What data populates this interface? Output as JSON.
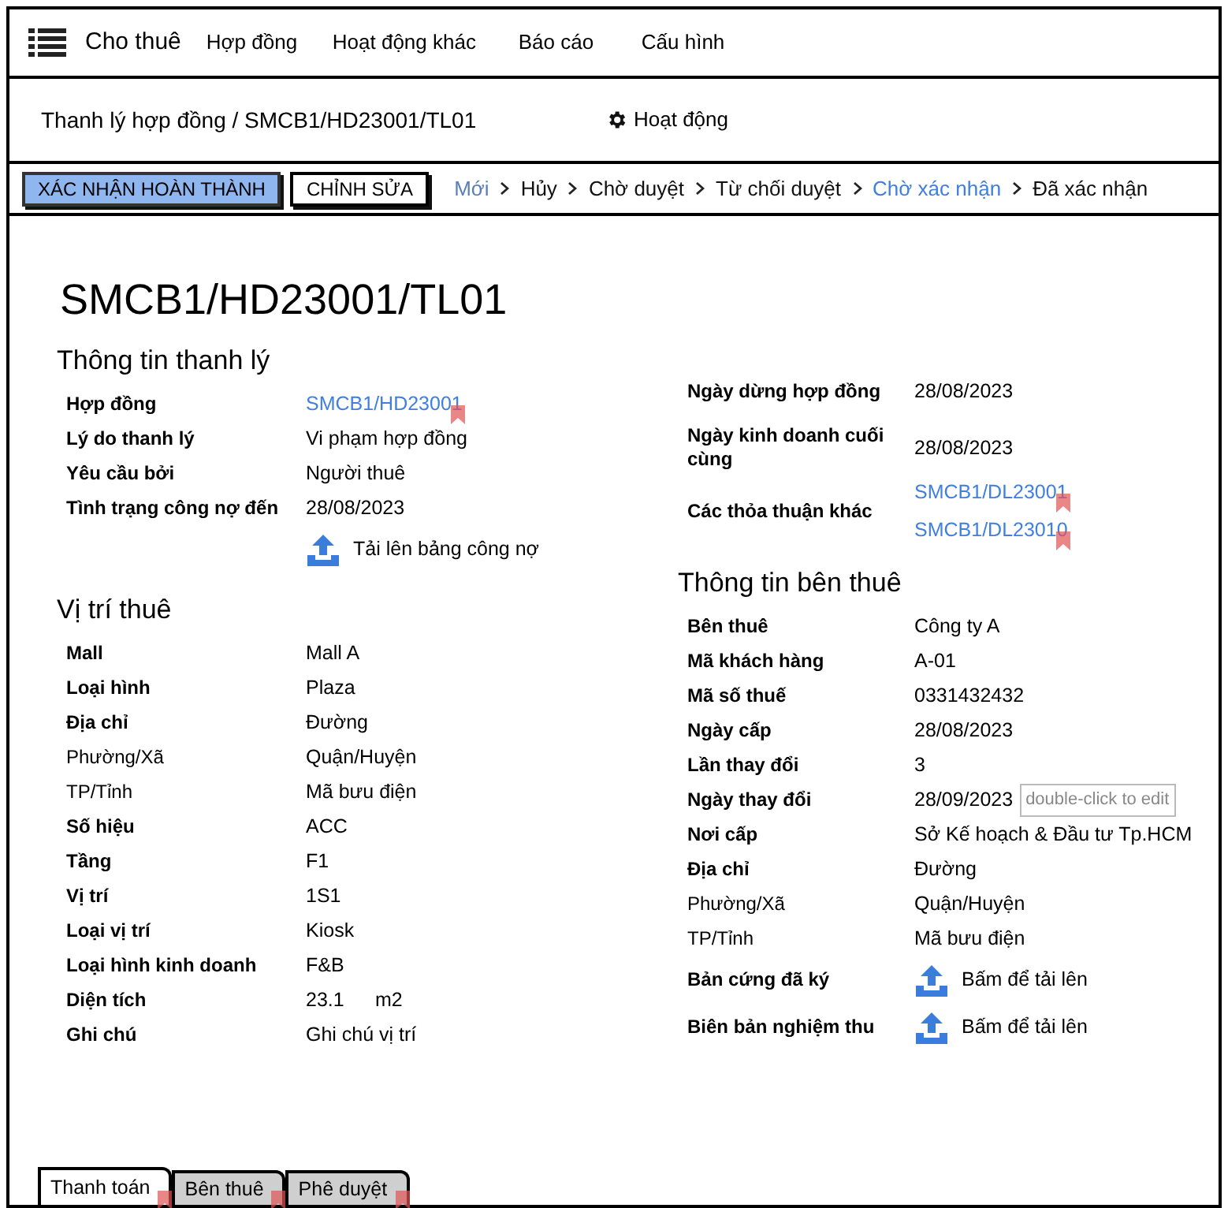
{
  "nav": {
    "brand": "Cho thuê",
    "items": [
      "Hợp đồng",
      "Hoạt động khác",
      "Báo cáo",
      "Cấu hình"
    ]
  },
  "breadcrumb": {
    "title": "Thanh lý hợp đồng / SMCB1/HD23001/TL01",
    "action": "Hoạt động"
  },
  "buttons": [
    {
      "label": "XÁC NHẬN HOÀN THÀNH",
      "primary": true
    },
    {
      "label": "CHỈNH SỬA",
      "primary": false
    }
  ],
  "steps": [
    {
      "label": "Mới",
      "done": true,
      "selected": false
    },
    {
      "label": "Hủy",
      "done": false,
      "selected": false
    },
    {
      "label": "Chờ duyệt",
      "done": false,
      "selected": false
    },
    {
      "label": "Từ chối duyệt",
      "done": false,
      "selected": false
    },
    {
      "label": "Chờ xác nhận",
      "done": false,
      "selected": true
    },
    {
      "label": "Đã xác nhận",
      "done": false,
      "selected": false
    }
  ],
  "record_title": "SMCB1/HD23001/TL01",
  "left_sections": [
    {
      "heading": "Thông tin thanh lý",
      "rows": [
        {
          "label": "Hợp đồng",
          "bold": true,
          "kind": "link",
          "value": "SMCB1/HD23001"
        },
        {
          "label": "Lý do thanh lý",
          "bold": true,
          "kind": "text",
          "value": "Vi phạm hợp đồng"
        },
        {
          "label": "Yêu cầu bởi",
          "bold": true,
          "kind": "text",
          "value": "Người thuê"
        },
        {
          "label": "Tình trạng công nợ đến",
          "bold": true,
          "kind": "text",
          "value": "28/08/2023"
        },
        {
          "kind": "upload",
          "value": "Tải lên bảng công nợ"
        }
      ]
    },
    {
      "heading": "Vị trí thuê",
      "rows": [
        {
          "label": "Mall",
          "bold": true,
          "kind": "text",
          "value": "Mall A"
        },
        {
          "label": "Loại hình",
          "bold": true,
          "kind": "text",
          "value": "Plaza"
        },
        {
          "label": "Địa chỉ",
          "bold": true,
          "kind": "text",
          "value": "Đường"
        },
        {
          "label": "Phường/Xã",
          "bold": false,
          "kind": "text",
          "value": "Quận/Huyện"
        },
        {
          "label": "TP/Tỉnh",
          "bold": false,
          "kind": "text",
          "value": "Mã bưu điện"
        },
        {
          "label": "Số hiệu",
          "bold": true,
          "kind": "text",
          "value": "ACC"
        },
        {
          "label": "Tầng",
          "bold": true,
          "kind": "text",
          "value": "F1"
        },
        {
          "label": "Vị trí",
          "bold": true,
          "kind": "text",
          "value": "1S1"
        },
        {
          "label": "Loại vị trí",
          "bold": true,
          "kind": "text",
          "value": "Kiosk"
        },
        {
          "label": "Loại hình kinh doanh",
          "bold": true,
          "kind": "text",
          "value": "F&B"
        },
        {
          "label": "Diện tích",
          "bold": true,
          "kind": "area",
          "value": "23.1",
          "unit": "m2"
        },
        {
          "label": "Ghi chú",
          "bold": true,
          "kind": "text",
          "value": "Ghi chú vị trí"
        }
      ]
    }
  ],
  "right_sections": [
    {
      "rows": [
        {
          "label": "Ngày dừng hợp đồng",
          "bold": true,
          "kind": "text",
          "value": "28/08/2023"
        },
        {
          "label": "Ngày kinh doanh cuối cùng",
          "bold": true,
          "kind": "text",
          "value": "28/08/2023"
        },
        {
          "label": "Các thỏa thuận khác",
          "bold": true,
          "kind": "links",
          "values": [
            "SMCB1/DL23001",
            "SMCB1/DL23010"
          ]
        }
      ]
    },
    {
      "heading": "Thông tin bên thuê",
      "rows": [
        {
          "label": "Bên thuê",
          "bold": true,
          "kind": "text",
          "value": "Công ty A"
        },
        {
          "label": "Mã khách hàng",
          "bold": true,
          "kind": "text",
          "value": "A-01"
        },
        {
          "label": "Mã số thuế",
          "bold": true,
          "kind": "text",
          "value": "0331432432"
        },
        {
          "label": "Ngày cấp",
          "bold": true,
          "kind": "text",
          "value": "28/08/2023"
        },
        {
          "label": "Lần thay đổi",
          "bold": true,
          "kind": "text",
          "value": "3"
        },
        {
          "label": "Ngày thay đổi",
          "bold": true,
          "kind": "text",
          "value": "28/09/2023",
          "tooltip": "double-click to edit"
        },
        {
          "label": "Nơi cấp",
          "bold": true,
          "kind": "text",
          "value": "Sở Kế hoạch & Đầu tư Tp.HCM"
        },
        {
          "label": "Địa chỉ",
          "bold": true,
          "kind": "text",
          "value": "Đường"
        },
        {
          "label": "Phường/Xã",
          "bold": false,
          "kind": "text",
          "value": "Quận/Huyện"
        },
        {
          "label": "TP/Tỉnh",
          "bold": false,
          "kind": "text",
          "value": "Mã bưu điện"
        },
        {
          "label": "Bản cứng đã ký",
          "bold": true,
          "kind": "upload",
          "value": "Bấm để tải lên"
        },
        {
          "label": "Biên bản nghiệm thu",
          "bold": true,
          "kind": "upload",
          "value": "Bấm để tải lên"
        }
      ]
    }
  ],
  "tabs": [
    {
      "label": "Thanh toán",
      "selected": true
    },
    {
      "label": "Bên thuê",
      "selected": false
    },
    {
      "label": "Phê duyệt",
      "selected": false
    }
  ]
}
